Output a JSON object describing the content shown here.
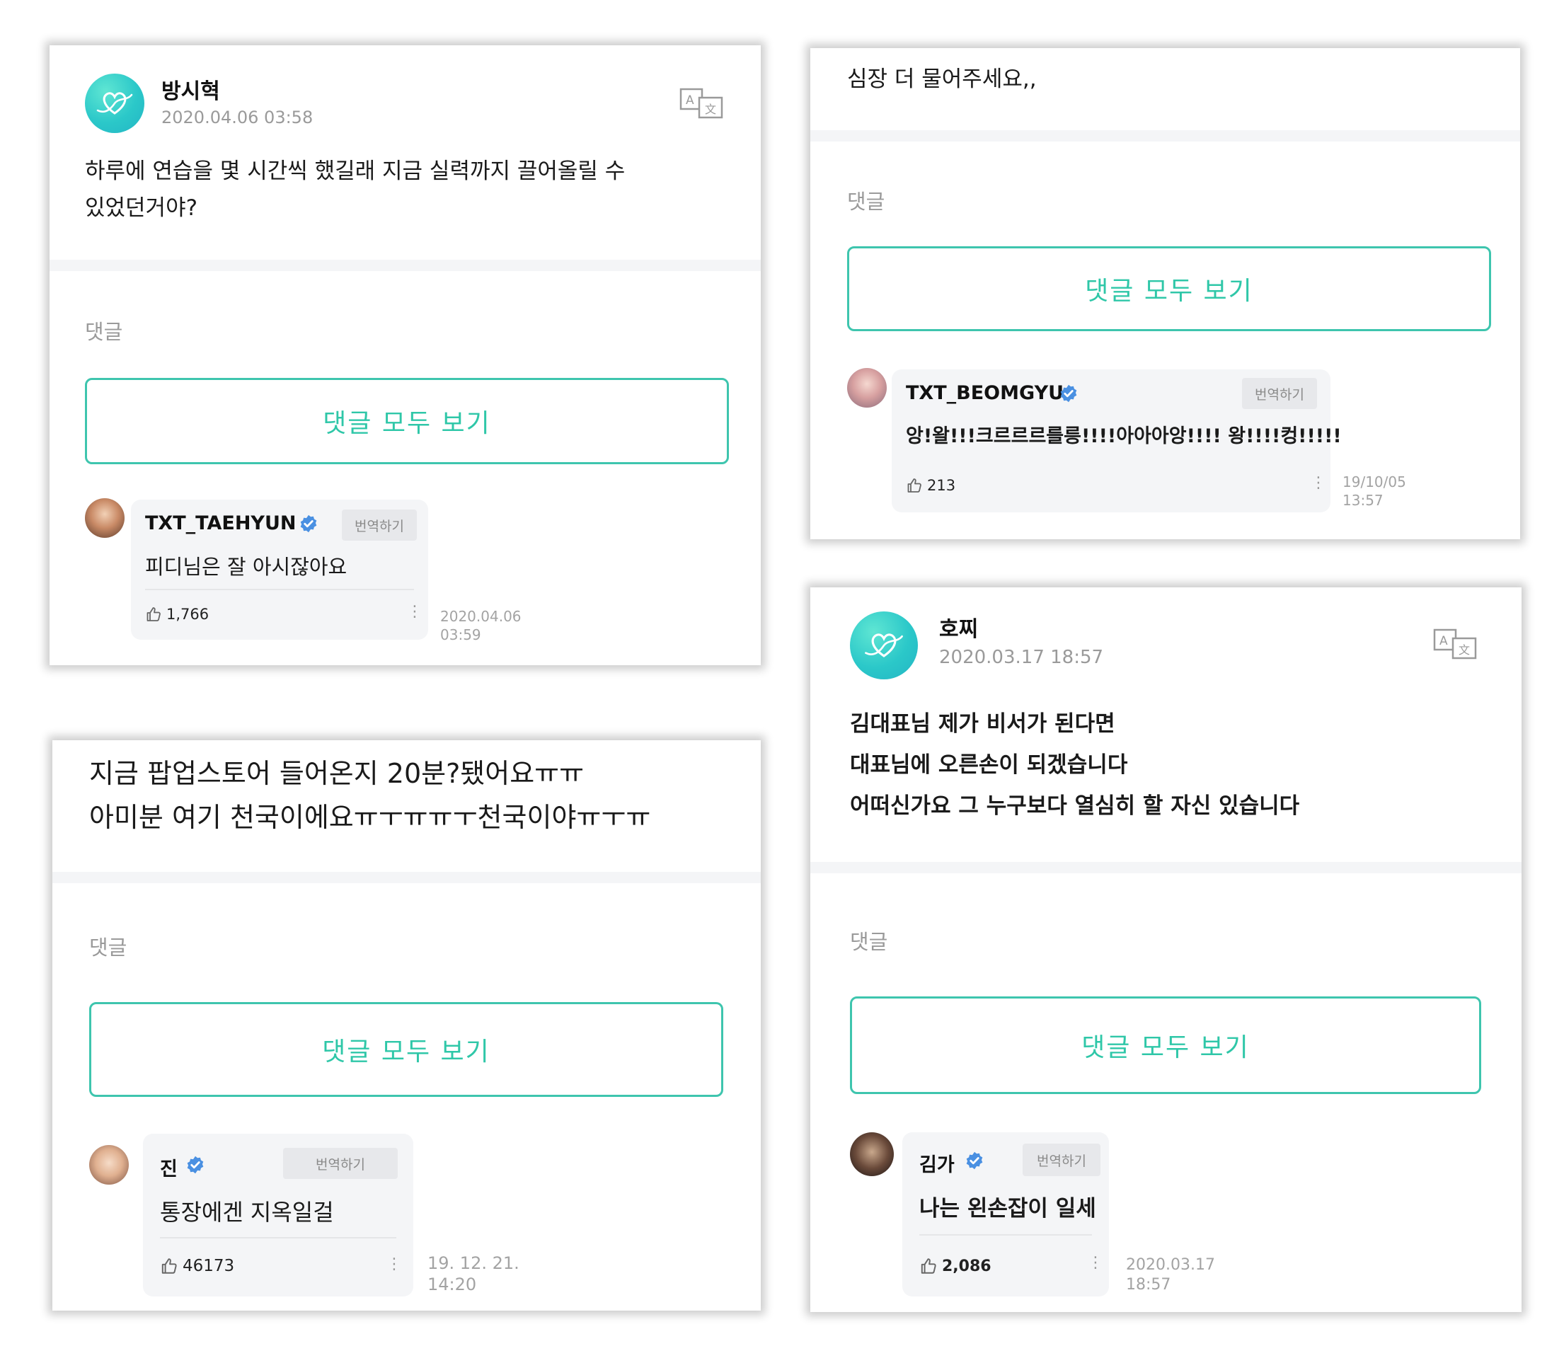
{
  "ui": {
    "accent": "#3ec5ae",
    "verified_color": "#4a90e2",
    "translate_label": "번역하기",
    "comments_label": "댓글",
    "view_all_label": "댓글 모두 보기"
  },
  "cards": {
    "top_left": {
      "author": "방시혁",
      "date": "2020.04.06 03:58",
      "body": "하루에 연습을 몇 시간씩 했길래 지금 실력까지 끌어올릴 수\n있었던거야?",
      "comment": {
        "name": "TXT_TAEHYUN",
        "text": "피디님은 잘 아시잖아요",
        "likes": "1,766",
        "date": "2020.04.06\n03:59"
      }
    },
    "top_right": {
      "body": "심장 더 물어주세요,,",
      "comment": {
        "name": "TXT_BEOMGYU",
        "text": "앙!왈!!!크르르르를릉!!!!아아아앙!!!! 왕!!!!컹!!!!!",
        "likes": "213",
        "date": "19/10/05\n13:57"
      }
    },
    "bottom_left": {
      "body": "지금 팝업스토어 들어온지 20분?됐어요ㅠㅠ\n아미분 여기 천국이에요ㅠㅜㅠㅠㅜ천국이야ㅠㅜㅠ",
      "comment": {
        "name": "진",
        "text": "통장에겐 지옥일걸",
        "likes": "46173",
        "date": "19. 12. 21.\n14:20"
      }
    },
    "bottom_right": {
      "author": "호찌",
      "date": "2020.03.17 18:57",
      "body": "김대표님 제가 비서가 된다면\n대표님에 오른손이 되겠습니다\n어떠신가요 그 누구보다 열심히 할 자신 있습니다",
      "comment": {
        "name": "김가",
        "text": "나는 왼손잡이 일세",
        "likes": "2,086",
        "date": "2020.03.17\n18:57"
      }
    }
  }
}
